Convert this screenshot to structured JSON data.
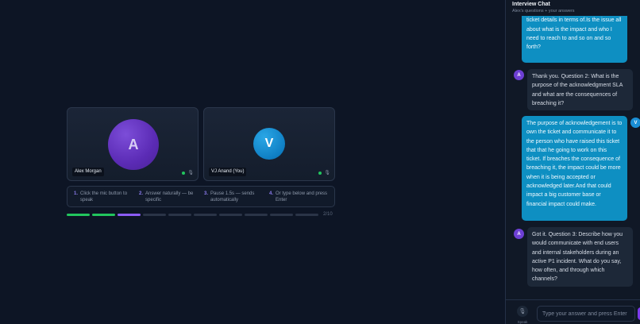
{
  "participants": {
    "interviewer": {
      "initial": "A",
      "name": "Alex Morgan"
    },
    "candidate": {
      "initial": "V",
      "name": "VJ Anand (You)"
    }
  },
  "hints": [
    {
      "num": "1.",
      "text": "Click the mic button to speak"
    },
    {
      "num": "2.",
      "text": "Answer naturally — be specific"
    },
    {
      "num": "3.",
      "text": "Pause 1.5s — sends automatically"
    },
    {
      "num": "4.",
      "text": "Or type below and press Enter"
    }
  ],
  "progress": {
    "label": "2/10",
    "total": 10,
    "completed": 2,
    "active_index": 2
  },
  "chat": {
    "title": "Interview Chat",
    "subtitle": "Alex's questions + your answers",
    "messages": [
      {
        "role": "user",
        "text": "production outage, I will check the ticket details in terms of.Is the issue all about what is the impact and who I need to reach to and so on and so forth?"
      },
      {
        "role": "ai",
        "avatar": "A",
        "text": "Thank you. Question 2: What is the purpose of the acknowledgment SLA and what are the consequences of breaching it?"
      },
      {
        "role": "user",
        "avatar": "V",
        "text": "The purpose of acknowledgement is to own the ticket and communicate it to the person who have raised this ticket that that he going to work on this ticket. If breaches the consequence of breaching it, the impact could be more when it is being accepted or acknowledged later.And that could impact a big customer base or financial impact could make."
      },
      {
        "role": "ai",
        "avatar": "A",
        "text": "Got it. Question 3: Describe how you would communicate with end users and internal stakeholders during an active P1 incident. What do you say, how often, and through which channels?"
      }
    ],
    "input_placeholder": "Type your answer and press Enter",
    "speak_label": "Speak"
  },
  "colors": {
    "background": "#0d1525",
    "user_bubble": "#0e8fc2",
    "ai_bubble": "#1d2838",
    "accent_purple": "#8b5cf6",
    "progress_done": "#22c55e"
  },
  "icons": [
    "mic-icon",
    "speak-mic-icon",
    "send-icon"
  ]
}
